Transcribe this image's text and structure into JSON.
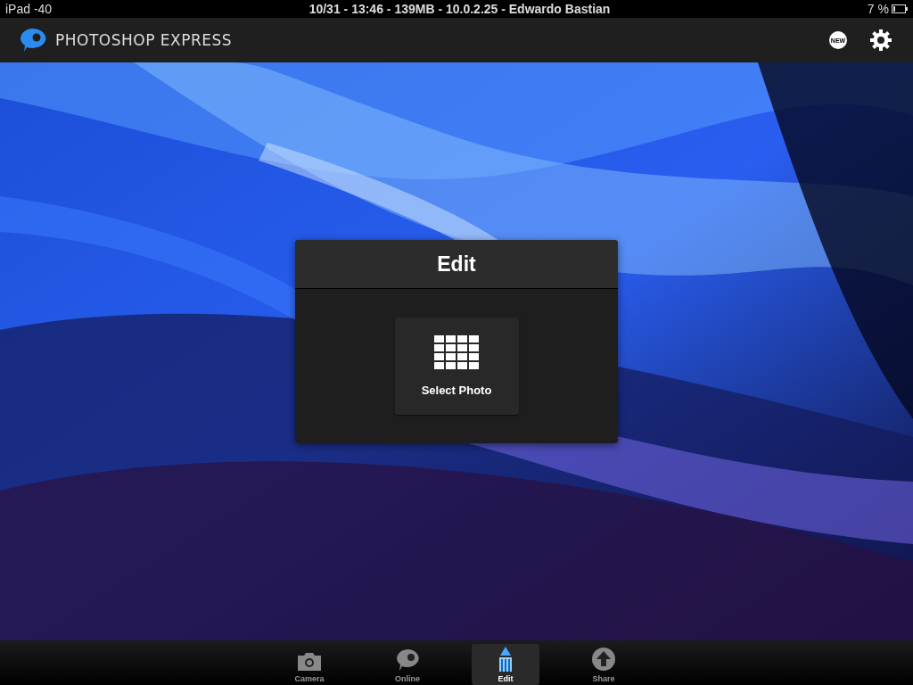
{
  "status_bar": {
    "device": "iPad -40",
    "center": "10/31 - 13:46 - 139MB - 10.0.2.25 - Edwardo Bastian",
    "battery": "7 %"
  },
  "app_bar": {
    "title": "PHOTOSHOP EXPRESS",
    "badge": "NEW"
  },
  "dialog": {
    "title": "Edit",
    "action": "Select Photo"
  },
  "tabs": [
    {
      "label": "Camera",
      "kind": "camera",
      "selected": false
    },
    {
      "label": "Online",
      "kind": "online",
      "selected": false
    },
    {
      "label": "Edit",
      "kind": "edit",
      "selected": true
    },
    {
      "label": "Share",
      "kind": "share",
      "selected": false
    }
  ]
}
